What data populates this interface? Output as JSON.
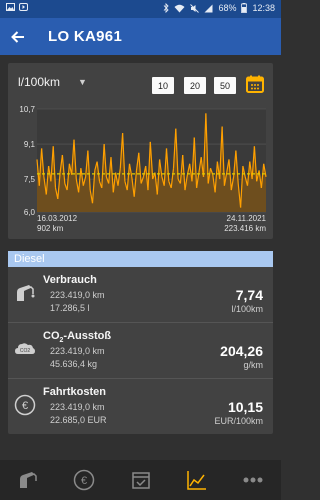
{
  "status_bar": {
    "battery": "68%",
    "time": "12:38",
    "icons": [
      "photo-icon",
      "play-icon",
      "bluetooth-icon",
      "wifi-icon",
      "mute-icon",
      "signal-icon",
      "battery-icon"
    ]
  },
  "app_bar": {
    "title": "LO KA961",
    "back_icon": "arrow-left-icon"
  },
  "chart_card": {
    "unit_selector": "l/100km",
    "range_buttons": [
      "10",
      "20",
      "50"
    ],
    "calendar_icon": "calendar-icon",
    "start_date": "16.03.2012",
    "start_km": "902 km",
    "end_date": "24.11.2021",
    "end_km": "223.416 km",
    "colors": {
      "line": "#ffa000",
      "fill": "#6e4e1e",
      "average": "#e0d000"
    }
  },
  "chart_data": {
    "type": "area",
    "title": "",
    "xlabel": "",
    "ylabel": "",
    "ylim": [
      6.0,
      10.7
    ],
    "y_ticks": [
      "10,7",
      "9,1",
      "7,5",
      "6,0"
    ],
    "x_start": "16.03.2012",
    "x_end": "24.11.2021",
    "average": 7.74,
    "series": [
      {
        "values": [
          8.4,
          7.2,
          8.9,
          7.6,
          6.8,
          8.1,
          7.4,
          9.0,
          7.1,
          6.6,
          7.8,
          8.6,
          7.3,
          7.0,
          8.2,
          7.7,
          9.3,
          7.5,
          6.9,
          8.0,
          7.2,
          7.6,
          8.8,
          7.0,
          6.4,
          7.9,
          8.3,
          7.4,
          7.1,
          9.1,
          7.6,
          7.3,
          8.5,
          6.9,
          7.8,
          7.2,
          8.0,
          9.6,
          7.4,
          7.0,
          8.2,
          7.6,
          6.7,
          7.9,
          8.7,
          7.3,
          7.6,
          8.1,
          7.0,
          9.2,
          7.5,
          7.8,
          6.8,
          8.4,
          7.6,
          7.2,
          8.9,
          7.4,
          7.1,
          8.0,
          9.8,
          7.5,
          7.3,
          8.6,
          7.0,
          7.7,
          8.2,
          7.4,
          9.4,
          7.1,
          7.8,
          8.5,
          7.6,
          10.5,
          7.3,
          8.0,
          7.7,
          6.9,
          8.3,
          7.5,
          9.9,
          7.2,
          7.8,
          8.4,
          7.0,
          7.6,
          8.8,
          7.3,
          6.2,
          8.1,
          7.6,
          7.2,
          8.3,
          7.5,
          9.0,
          7.4,
          7.9,
          7.1,
          8.2,
          7.6
        ]
      }
    ]
  },
  "stats": {
    "section_title": "Diesel",
    "rows": [
      {
        "title": "Verbrauch",
        "sub1": "223.419,0 km",
        "sub2": "17.286,5 l",
        "value": "7,74",
        "unit": "l/100km",
        "icon": "fuel-pump-icon"
      },
      {
        "title_main": "CO",
        "title_sub": "2",
        "title_rest": "-Ausstoß",
        "sub1": "223.419,0 km",
        "sub2": "45.636,4 kg",
        "value": "204,26",
        "unit": "g/km",
        "icon": "co2-cloud-icon"
      },
      {
        "title": "Fahrtkosten",
        "sub1": "223.419,0 km",
        "sub2": "22.685,0 EUR",
        "value": "10,15",
        "unit": "EUR/100km",
        "icon": "euro-icon"
      }
    ]
  },
  "bottom_nav": {
    "items": [
      {
        "icon": "fuel-pump-icon",
        "active": false
      },
      {
        "icon": "euro-icon",
        "active": false
      },
      {
        "icon": "calendar-check-icon",
        "active": false
      },
      {
        "icon": "chart-line-icon",
        "active": true
      },
      {
        "icon": "more-icon",
        "active": false
      }
    ]
  }
}
